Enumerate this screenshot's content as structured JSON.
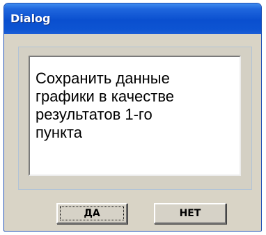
{
  "window": {
    "title": "Dialog"
  },
  "message": {
    "text": "Сохранить данные\nграфики в качестве\nрезультатов 1-го\nпункта"
  },
  "buttons": {
    "yes_label": "ДА",
    "no_label": "НЕТ"
  },
  "colors": {
    "titlebar": "#0a4fcf",
    "window_bg": "#d9d4c6",
    "border": "#1f4fb3"
  }
}
